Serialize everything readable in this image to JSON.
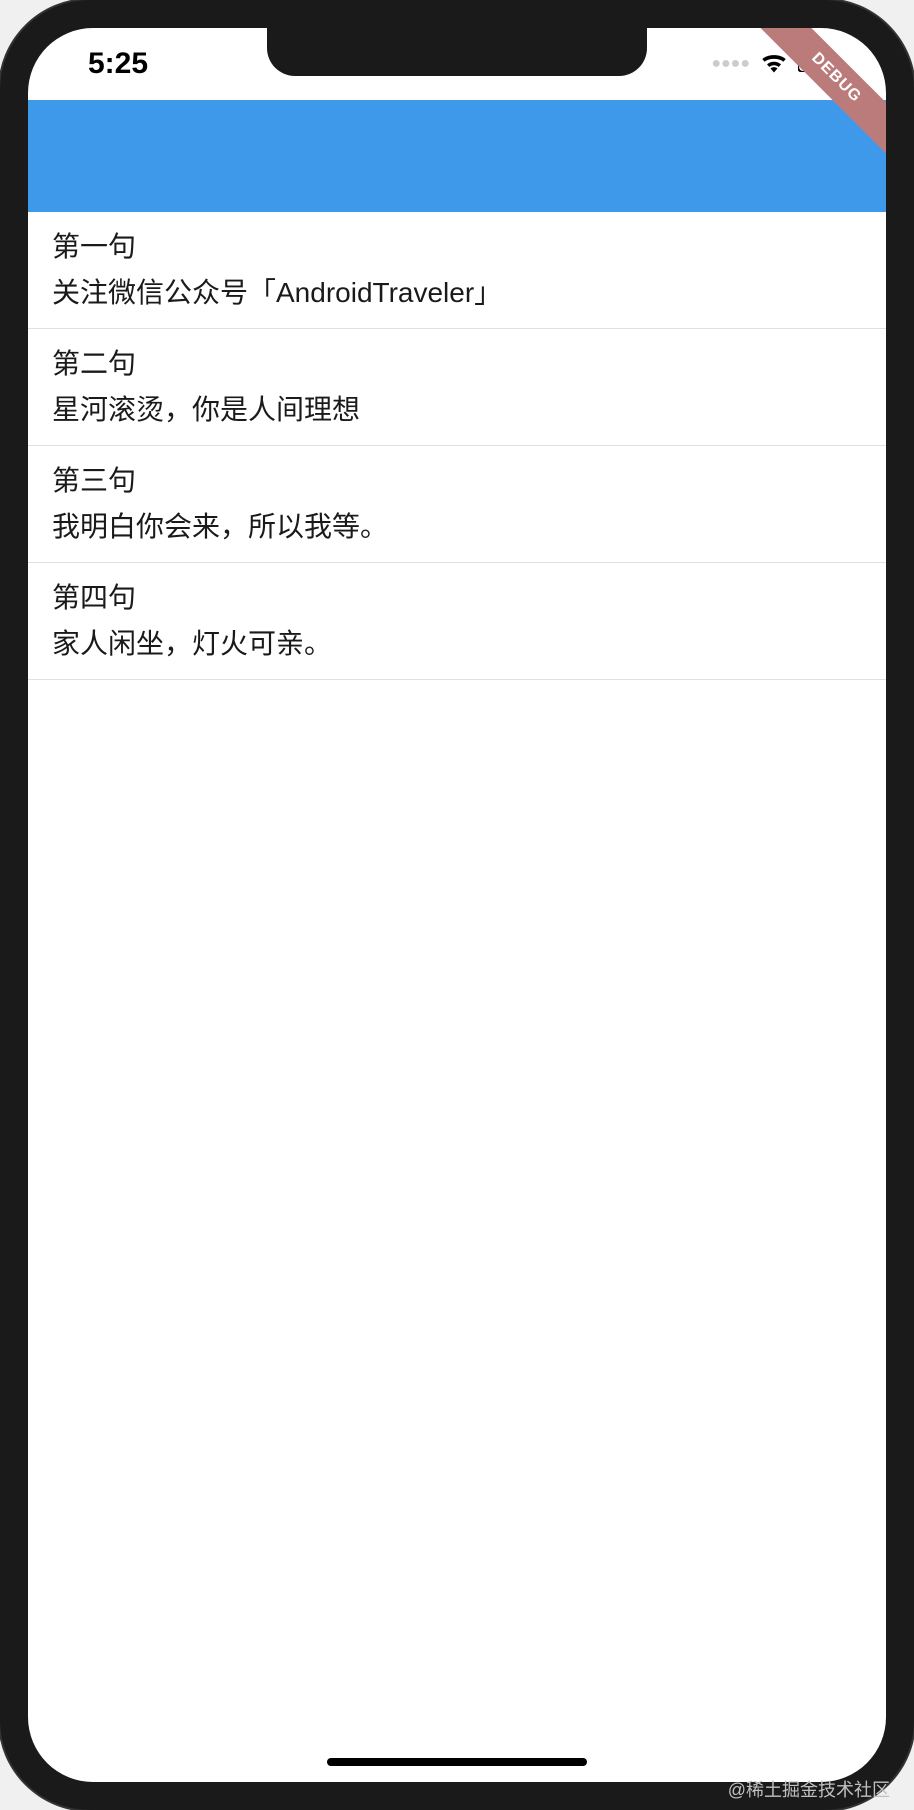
{
  "status_bar": {
    "time": "5:25"
  },
  "debug_banner": {
    "label": "DEBUG"
  },
  "list": {
    "items": [
      {
        "title": "第一句",
        "subtitle": "关注微信公众号「AndroidTraveler」"
      },
      {
        "title": "第二句",
        "subtitle": "星河滚烫，你是人间理想"
      },
      {
        "title": "第三句",
        "subtitle": "我明白你会来，所以我等。"
      },
      {
        "title": "第四句",
        "subtitle": "家人闲坐，灯火可亲。"
      }
    ]
  },
  "watermark": "@稀土掘金技术社区"
}
